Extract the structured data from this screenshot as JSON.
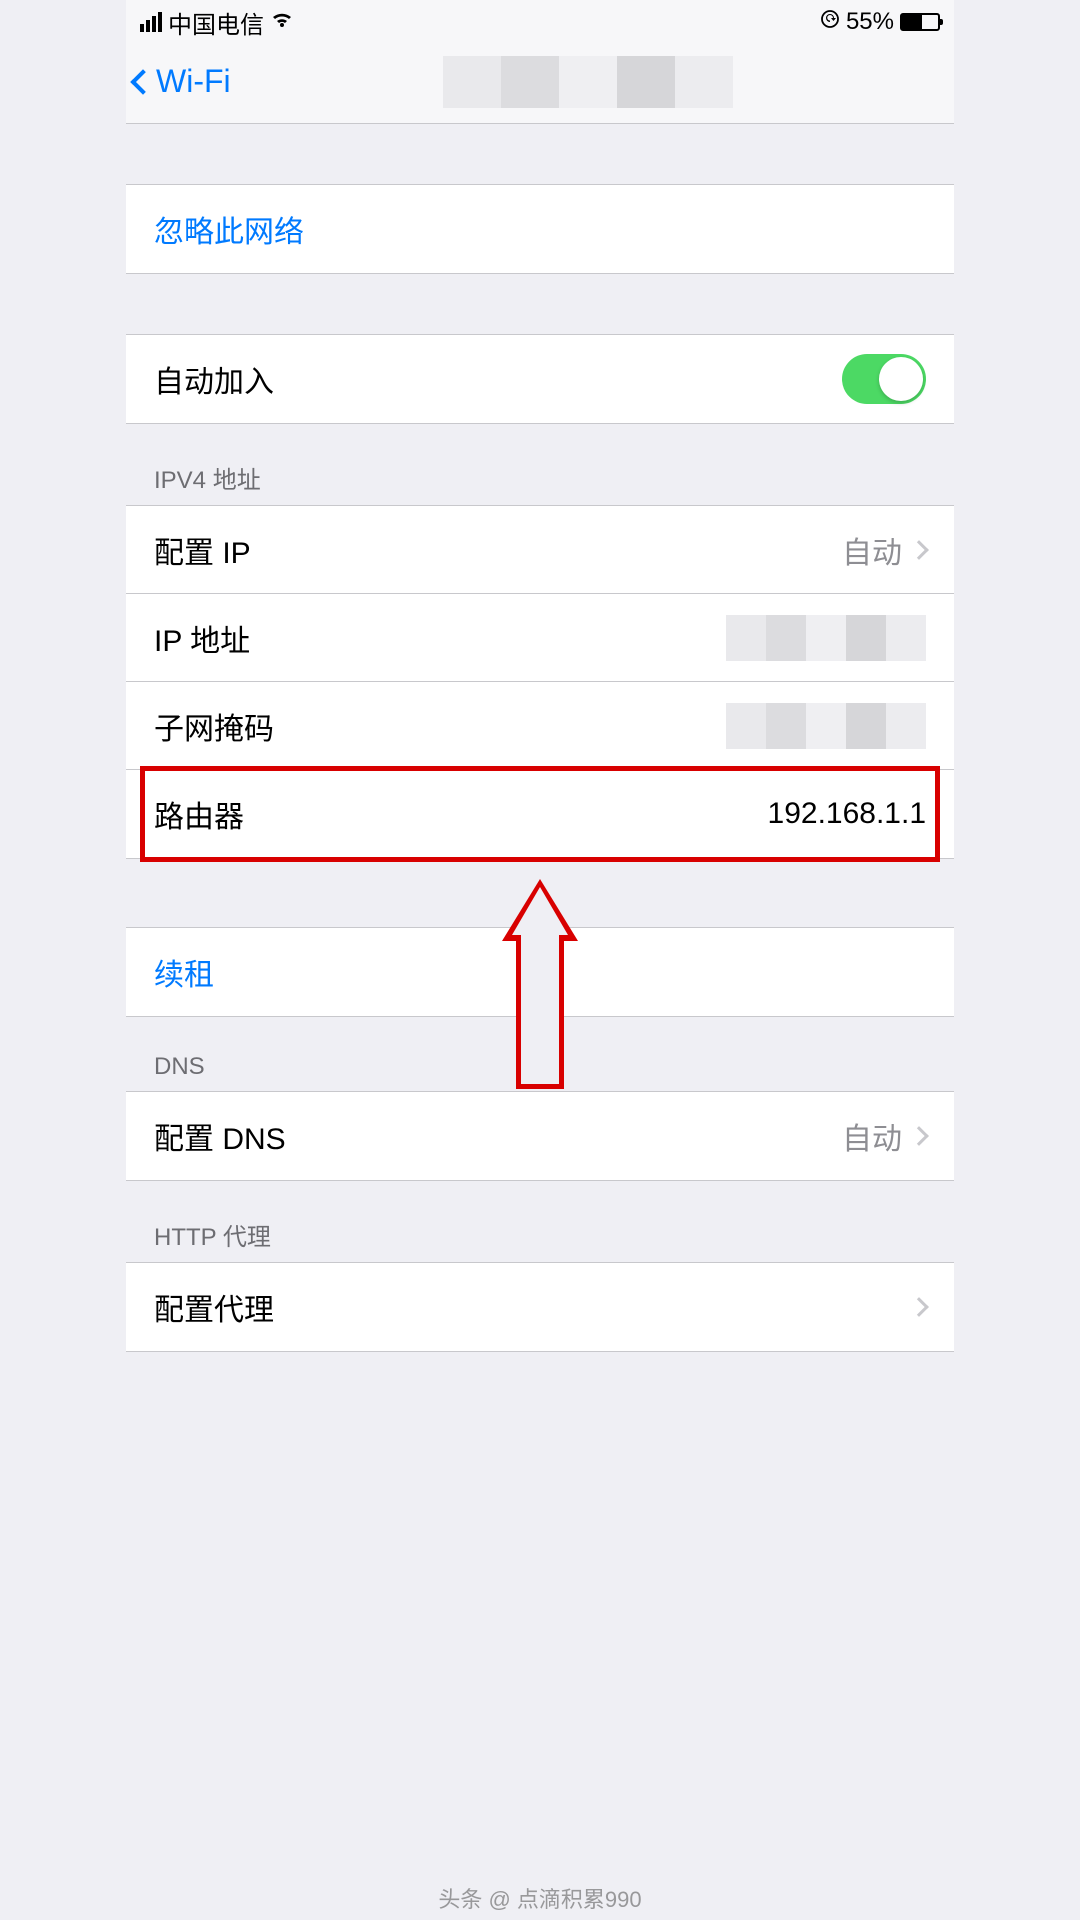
{
  "statusbar": {
    "carrier": "中国电信",
    "battery_pct": "55%"
  },
  "nav": {
    "back_label": "Wi-Fi"
  },
  "rows": {
    "forget": "忽略此网络",
    "auto_join": "自动加入",
    "ipv4_header": "IPV4 地址",
    "configure_ip_label": "配置 IP",
    "configure_ip_value": "自动",
    "ip_address_label": "IP 地址",
    "subnet_label": "子网掩码",
    "router_label": "路由器",
    "router_value": "192.168.1.1",
    "renew_lease": "续租",
    "dns_header": "DNS",
    "configure_dns_label": "配置 DNS",
    "configure_dns_value": "自动",
    "http_proxy_header": "HTTP 代理",
    "configure_proxy_label": "配置代理"
  },
  "watermark": "头条 @ 点滴积累990"
}
